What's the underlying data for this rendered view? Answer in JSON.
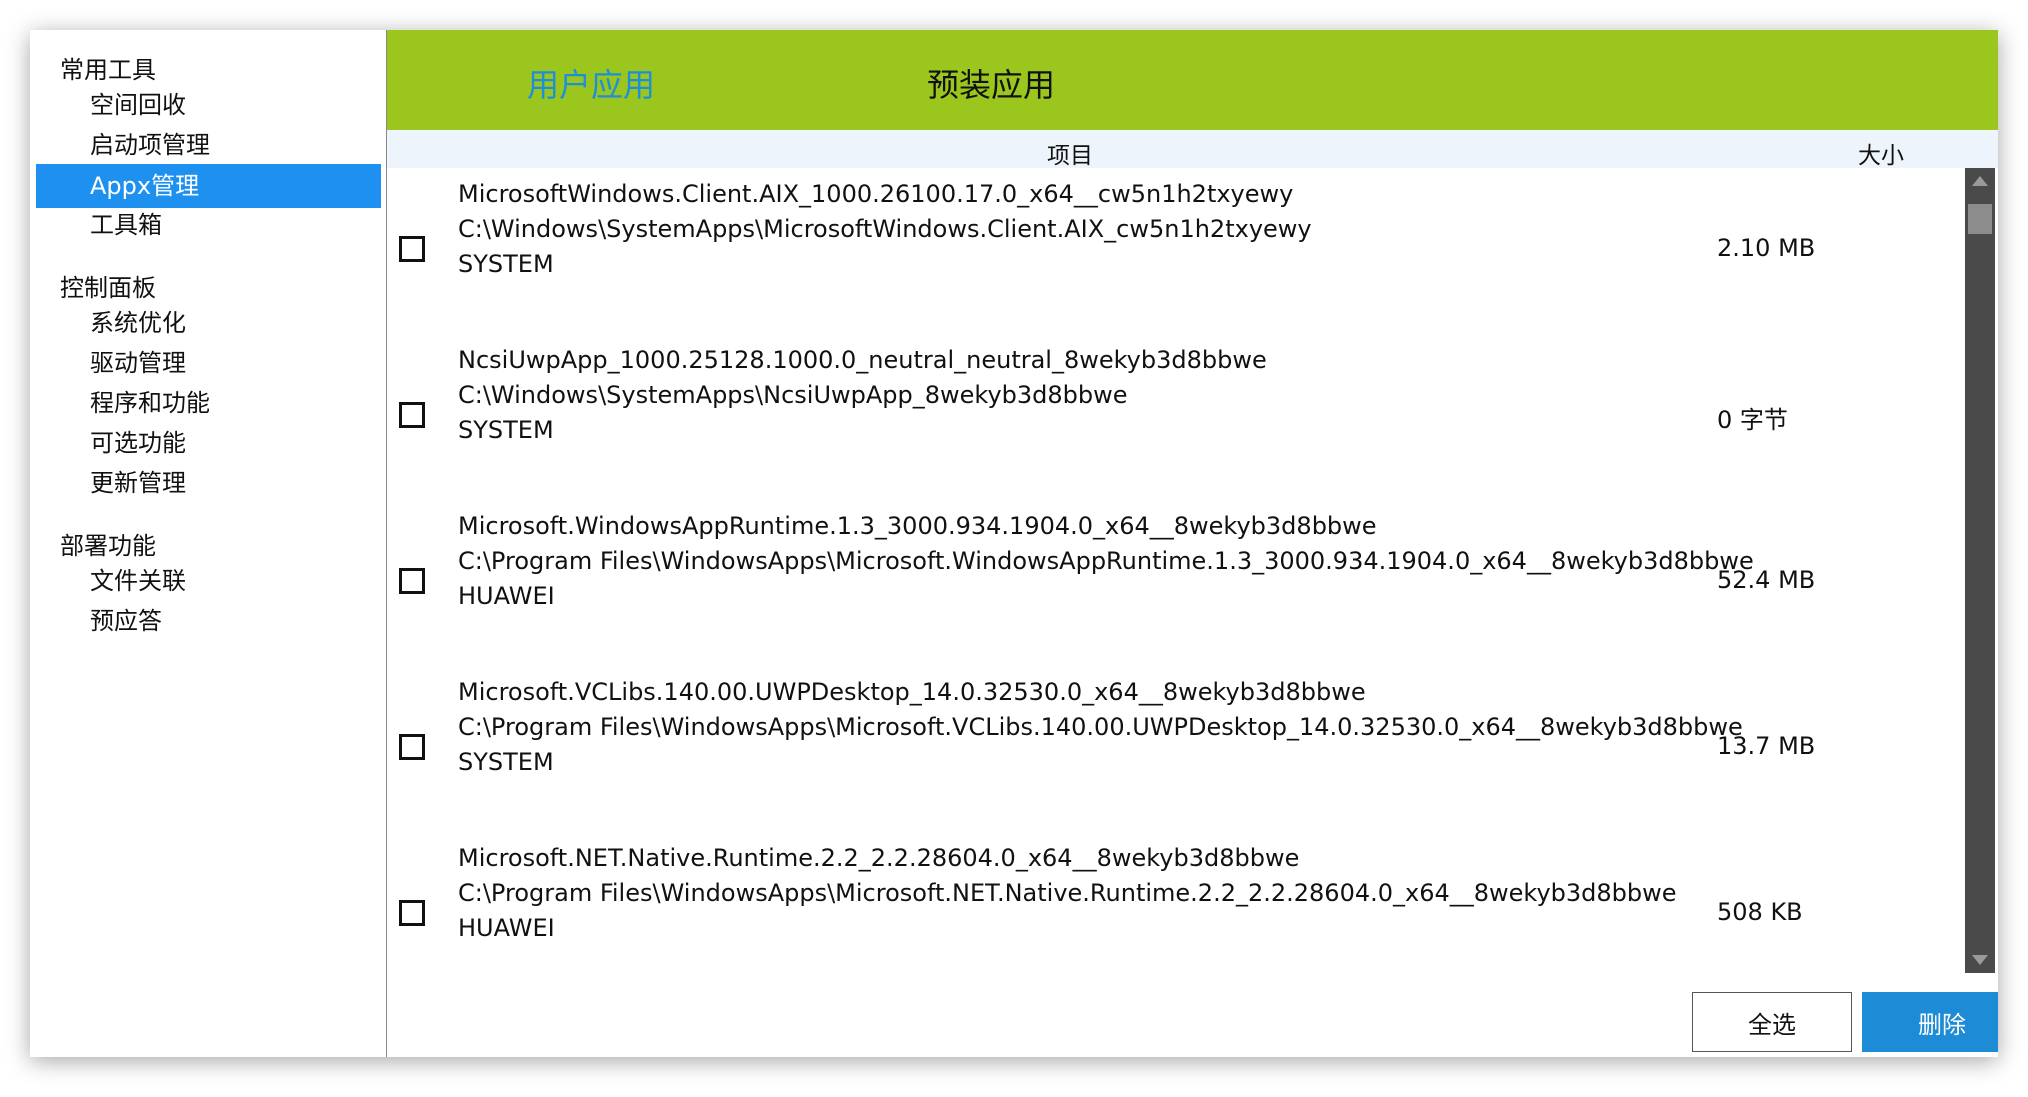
{
  "sidebar": {
    "groups": [
      {
        "label": "常用工具"
      },
      {
        "label": "控制面板"
      },
      {
        "label": "部署功能"
      }
    ],
    "items": [
      {
        "label": "空间回收"
      },
      {
        "label": "启动项管理"
      },
      {
        "label": "Appx管理"
      },
      {
        "label": "工具箱"
      },
      {
        "label": "系统优化"
      },
      {
        "label": "驱动管理"
      },
      {
        "label": "程序和功能"
      },
      {
        "label": "可选功能"
      },
      {
        "label": "更新管理"
      },
      {
        "label": "文件关联"
      },
      {
        "label": "预应答"
      }
    ],
    "active_item": "Appx管理"
  },
  "tabs": [
    {
      "label": "用户应用",
      "active": true
    },
    {
      "label": "预装应用",
      "active": false
    }
  ],
  "columns": {
    "item": "项目",
    "size": "大小"
  },
  "rows": [
    {
      "name": "MicrosoftWindows.Client.AIX_1000.26100.17.0_x64__cw5n1h2txyewy",
      "path": "C:\\Windows\\SystemApps\\MicrosoftWindows.Client.AIX_cw5n1h2txyewy",
      "owner": "SYSTEM",
      "size": "2.10 MB",
      "checked": false
    },
    {
      "name": "NcsiUwpApp_1000.25128.1000.0_neutral_neutral_8wekyb3d8bbwe",
      "path": "C:\\Windows\\SystemApps\\NcsiUwpApp_8wekyb3d8bbwe",
      "owner": "SYSTEM",
      "size": "0 字节",
      "checked": false
    },
    {
      "name": "Microsoft.WindowsAppRuntime.1.3_3000.934.1904.0_x64__8wekyb3d8bbwe",
      "path": "C:\\Program Files\\WindowsApps\\Microsoft.WindowsAppRuntime.1.3_3000.934.1904.0_x64__8wekyb3d8bbwe",
      "owner": "HUAWEI",
      "size": "52.4 MB",
      "checked": false
    },
    {
      "name": "Microsoft.VCLibs.140.00.UWPDesktop_14.0.32530.0_x64__8wekyb3d8bbwe",
      "path": "C:\\Program Files\\WindowsApps\\Microsoft.VCLibs.140.00.UWPDesktop_14.0.32530.0_x64__8wekyb3d8bbwe",
      "owner": "SYSTEM",
      "size": "13.7 MB",
      "checked": false
    },
    {
      "name": "Microsoft.NET.Native.Runtime.2.2_2.2.28604.0_x64__8wekyb3d8bbwe",
      "path": "C:\\Program Files\\WindowsApps\\Microsoft.NET.Native.Runtime.2.2_2.2.28604.0_x64__8wekyb3d8bbwe",
      "owner": "HUAWEI",
      "size": "508 KB",
      "checked": false
    }
  ],
  "buttons": {
    "select_all": "全选",
    "delete": "删除"
  },
  "colors": {
    "tab_bar": "#9ac61e",
    "active_tab_text": "#1e8fd8",
    "sidebar_active": "#1e90ef",
    "delete_button": "#1e8bd6",
    "scrollbar": "#4a4a4a"
  },
  "icons": {
    "scroll_up": "triangle-up-icon",
    "scroll_down": "triangle-down-icon"
  }
}
